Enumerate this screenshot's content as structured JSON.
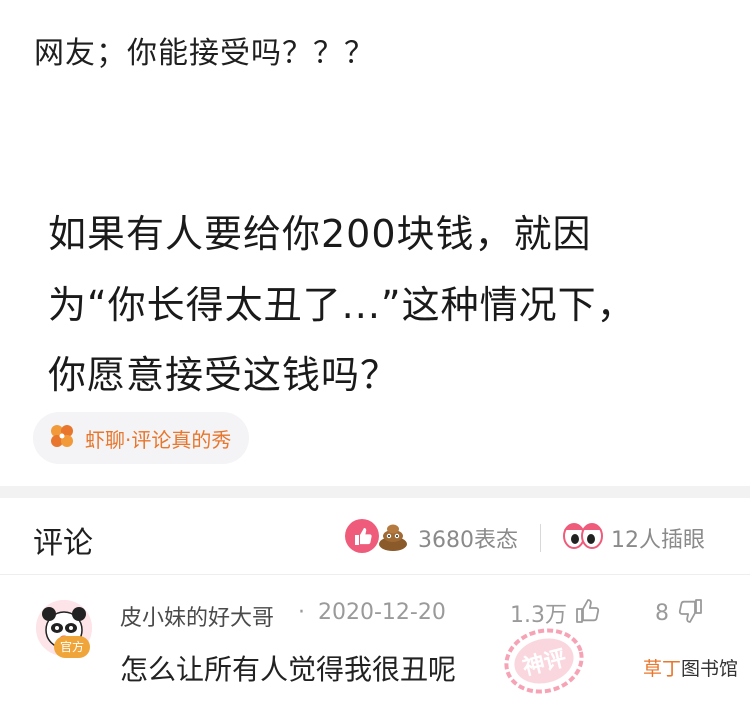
{
  "post": {
    "title": "网友；你能接受吗？？？"
  },
  "quote": {
    "lines": [
      "如果有人要给你200块钱，就因",
      "为“你长得太丑了...”这种情况下，",
      "你愿意接受这钱吗？"
    ]
  },
  "topic": {
    "label": "虾聊·评论真的秀",
    "icon": "four-petal-icon",
    "color": "#e8762c"
  },
  "comments_header": {
    "title": "评论",
    "reactions_count": "3680表态",
    "insert_eyes_count": "12人插眼"
  },
  "comment": {
    "author": "皮小妹的好大哥",
    "separator": "·",
    "date": "2020-12-20",
    "likes": "1.3万",
    "dislikes": "8",
    "badge": "官方",
    "text": "怎么让所有人觉得我很丑呢",
    "stamp": "神评"
  },
  "watermark": {
    "part1": "草丁",
    "part2": "图书馆"
  },
  "colors": {
    "accent": "#e8762c",
    "pink": "#ef5b7a",
    "muted": "#9a9a9a"
  }
}
